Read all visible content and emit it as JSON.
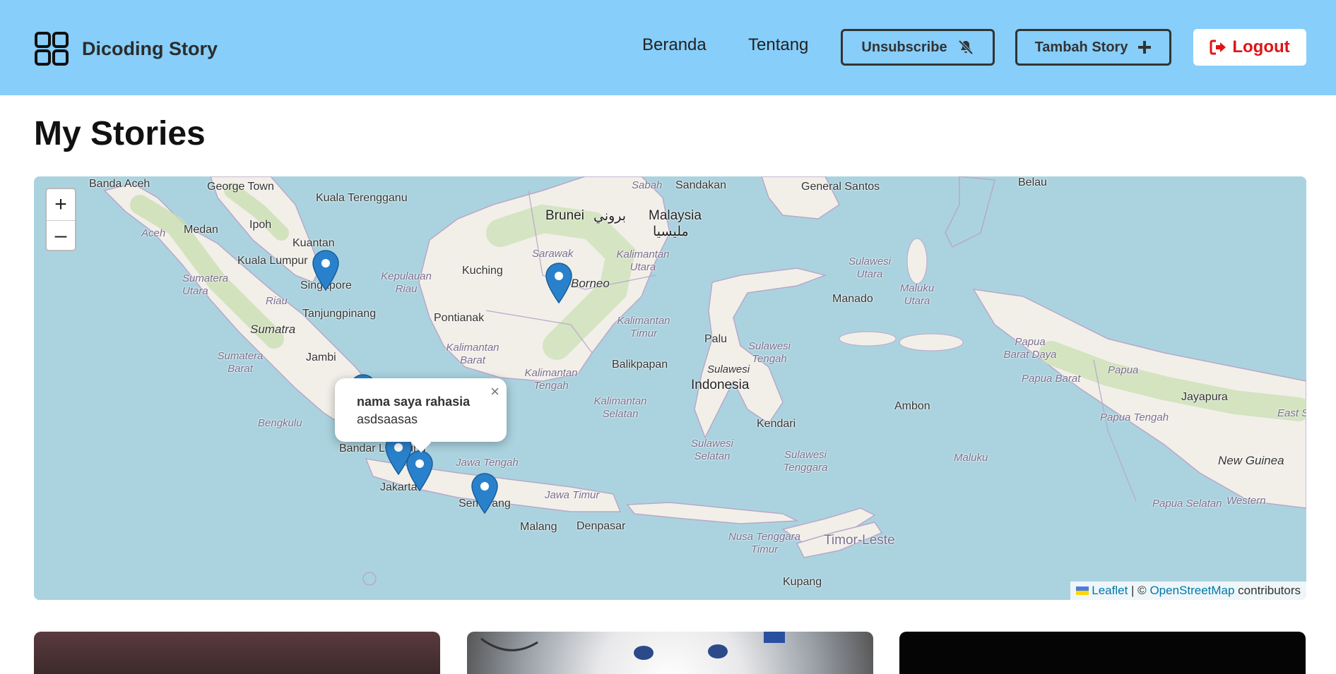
{
  "header": {
    "brand_title": "Dicoding Story",
    "nav": {
      "home": "Beranda",
      "about": "Tentang"
    },
    "unsubscribe_label": "Unsubscribe",
    "add_story_label": "Tambah Story",
    "logout_label": "Logout",
    "colors": {
      "background": "#87cefa",
      "logout_text": "#e01414"
    }
  },
  "page": {
    "title": "My Stories"
  },
  "map": {
    "labels": {
      "banda_aceh": "Banda Aceh",
      "george_town": "George Town",
      "kuala_terengganu": "Kuala Terengganu",
      "ipoh": "Ipoh",
      "medan": "Medan",
      "aceh": "Aceh",
      "kuantan": "Kuantan",
      "kuala_lumpur": "Kuala Lumpur",
      "sumatera_utara": "Sumatera Utara",
      "riau": "Riau",
      "kepulauan_riau": "Kepulauan Riau",
      "singapore": "Singapore",
      "tanjungpinang": "Tanjungpinang",
      "sumatra": "Sumatra",
      "jambi": "Jambi",
      "sumatera_barat": "Sumatera Barat",
      "bengkulu": "Bengkulu",
      "bandar_lampung": "Bandar Lampung",
      "jakarta": "Jakarta",
      "jawa_tengah": "Jawa Tengah",
      "semarang": "Semarang",
      "jawa_timur": "Jawa Timur",
      "malang": "Malang",
      "denpasar": "Denpasar",
      "sabah": "Sabah",
      "sandakan": "Sandakan",
      "brunei": "Brunei",
      "brunei_ar": "بروني",
      "malaysia": "Malaysia",
      "malaysia_ar": "مليسيا",
      "sarawak": "Sarawak",
      "kuching": "Kuching",
      "kalimantan_utara": "Kalimantan Utara",
      "borneo": "Borneo",
      "pontianak": "Pontianak",
      "kalimantan_barat": "Kalimantan Barat",
      "kalimantan_timur": "Kalimantan Timur",
      "kalimantan_tengah": "Kalimantan Tengah",
      "kalimantan_selatan": "Kalimantan Selatan",
      "balikpapan": "Balikpapan",
      "general_santos": "General Santos",
      "belau": "Belau",
      "sulawesi_utara": "Sulawesi Utara",
      "manado": "Manado",
      "maluku_utara": "Maluku Utara",
      "palu": "Palu",
      "sulawesi_tengah": "Sulawesi Tengah",
      "sulawesi": "Sulawesi",
      "indonesia": "Indonesia",
      "kendari": "Kendari",
      "sulawesi_selatan": "Sulawesi Selatan",
      "sulawesi_tenggara": "Sulawesi Tenggara",
      "ambon": "Ambon",
      "maluku": "Maluku",
      "papua_barat_daya": "Papua Barat Daya",
      "papua_barat": "Papua Barat",
      "papua": "Papua",
      "jayapura": "Jayapura",
      "papua_tengah": "Papua Tengah",
      "east_sepik": "East Sep",
      "new_guinea": "New Guinea",
      "papua_selatan": "Papua Selatan",
      "western": "Western",
      "nusa_tenggara_timur": "Nusa Tenggara Timur",
      "timor_leste": "Timor-Leste",
      "kupang": "Kupang"
    },
    "zoom_in": "+",
    "zoom_out": "–",
    "popup": {
      "title": "nama saya rahasia",
      "description": "asdsaasas",
      "close": "×"
    },
    "attribution": {
      "leaflet": "Leaflet",
      "separator": " | © ",
      "osm": "OpenStreetMap",
      "suffix": " contributors"
    },
    "marker_color": "#2a81cb"
  }
}
